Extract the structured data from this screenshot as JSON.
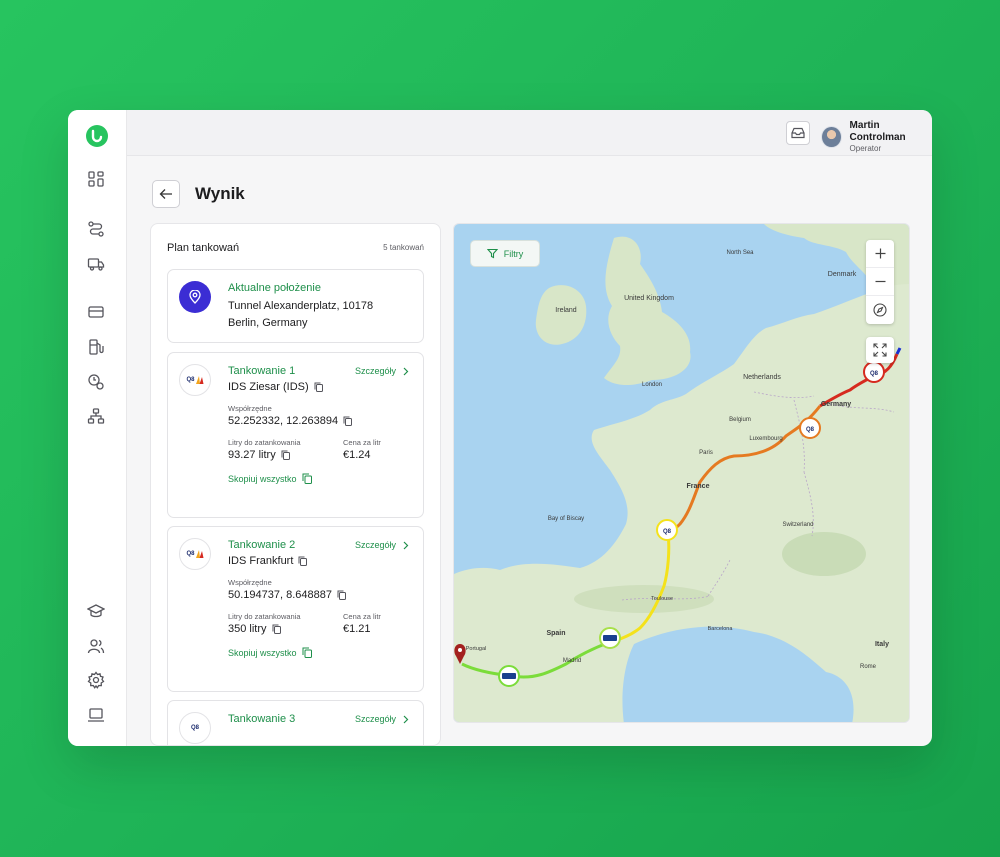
{
  "header": {
    "user": {
      "name": "Martin Controlman",
      "role": "Operator"
    }
  },
  "page": {
    "title": "Wynik"
  },
  "plan": {
    "title": "Plan tankowań",
    "count": "5 tankowań",
    "current": {
      "title": "Aktualne położenie",
      "address_line1": "Tunnel Alexanderplatz, 10178",
      "address_line2": "Berlin, Germany"
    },
    "stops": [
      {
        "title": "Tankowanie 1",
        "details_label": "Szczegóły",
        "station": "IDS Ziesar (IDS)",
        "coords_label": "Współrzędne",
        "coords": "52.252332, 12.263894",
        "liters_label": "Litry do zatankowania",
        "liters": "93.27 litry",
        "price_label": "Cena za litr",
        "price": "€1.24",
        "copy_all": "Skopiuj wszystko"
      },
      {
        "title": "Tankowanie 2",
        "details_label": "Szczegóły",
        "station": "IDS Frankfurt",
        "coords_label": "Współrzędne",
        "coords": "50.194737, 8.648887",
        "liters_label": "Litry do zatankowania",
        "liters": "350 litry",
        "price_label": "Cena za litr",
        "price": "€1.21",
        "copy_all": "Skopiuj wszystko"
      },
      {
        "title": "Tankowanie 3",
        "details_label": "Szczegóły"
      }
    ],
    "station_logo_text": "Q8"
  },
  "map": {
    "filter_label": "Filtry",
    "labels": {
      "north_sea": "North Sea",
      "denmark": "Denmark",
      "ireland": "Ireland",
      "united_kingdom": "United Kingdom",
      "london": "London",
      "netherlands": "Netherlands",
      "belgium": "Belgium",
      "luxembourg": "Luxembourg",
      "germany": "Germany",
      "paris": "Paris",
      "france": "France",
      "bay_of_biscay": "Bay of Biscay",
      "switzerland": "Switzerland",
      "spain": "Spain",
      "madrid": "Madrid",
      "portugal": "Portugal",
      "italy": "Italy",
      "rome": "Rome",
      "toulouse": "Toulouse",
      "barcelona": "Barcelona"
    }
  },
  "colors": {
    "accent": "#1e8f4a",
    "pin": "#3b2dd4",
    "route_start": "#1a2fd1",
    "route_red": "#d62a1f",
    "route_orange": "#e57a21",
    "route_yellow": "#f4e21b",
    "route_green": "#7bdc3a"
  }
}
